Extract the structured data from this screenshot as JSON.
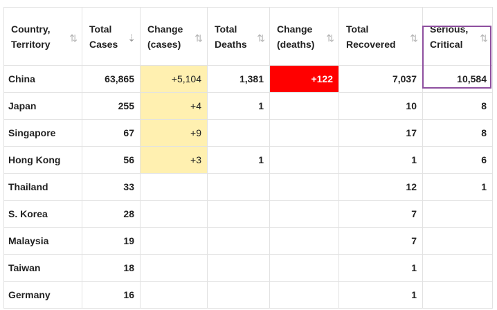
{
  "table": {
    "columns": [
      {
        "label_line1": "Country,",
        "label_line2": "Territory",
        "sort_icon": "sort-updown-icon"
      },
      {
        "label_line1": "Total",
        "label_line2": "Cases",
        "sort_icon": "sort-descending-icon"
      },
      {
        "label_line1": "Change",
        "label_line2": "(cases)",
        "sort_icon": "sort-updown-icon"
      },
      {
        "label_line1": "Total",
        "label_line2": "Deaths",
        "sort_icon": "sort-updown-icon"
      },
      {
        "label_line1": "Change",
        "label_line2": "(deaths)",
        "sort_icon": "sort-updown-icon"
      },
      {
        "label_line1": "Total",
        "label_line2": "Recovered",
        "sort_icon": "sort-updown-icon"
      },
      {
        "label_line1": "Serious,",
        "label_line2": "Critical",
        "sort_icon": "sort-updown-icon"
      }
    ],
    "rows": [
      {
        "country": "China",
        "total_cases": "63,865",
        "change_cases": "+5,104",
        "total_deaths": "1,381",
        "change_deaths": "+122",
        "total_recovered": "7,037",
        "serious_critical": "10,584"
      },
      {
        "country": "Japan",
        "total_cases": "255",
        "change_cases": "+4",
        "total_deaths": "1",
        "change_deaths": "",
        "total_recovered": "10",
        "serious_critical": "8"
      },
      {
        "country": "Singapore",
        "total_cases": "67",
        "change_cases": "+9",
        "total_deaths": "",
        "change_deaths": "",
        "total_recovered": "17",
        "serious_critical": "8"
      },
      {
        "country": "Hong Kong",
        "total_cases": "56",
        "change_cases": "+3",
        "total_deaths": "1",
        "change_deaths": "",
        "total_recovered": "1",
        "serious_critical": "6"
      },
      {
        "country": "Thailand",
        "total_cases": "33",
        "change_cases": "",
        "total_deaths": "",
        "change_deaths": "",
        "total_recovered": "12",
        "serious_critical": "1"
      },
      {
        "country": "S. Korea",
        "total_cases": "28",
        "change_cases": "",
        "total_deaths": "",
        "change_deaths": "",
        "total_recovered": "7",
        "serious_critical": ""
      },
      {
        "country": "Malaysia",
        "total_cases": "19",
        "change_cases": "",
        "total_deaths": "",
        "change_deaths": "",
        "total_recovered": "7",
        "serious_critical": ""
      },
      {
        "country": "Taiwan",
        "total_cases": "18",
        "change_cases": "",
        "total_deaths": "",
        "change_deaths": "",
        "total_recovered": "1",
        "serious_critical": ""
      },
      {
        "country": "Germany",
        "total_cases": "16",
        "change_cases": "",
        "total_deaths": "",
        "change_deaths": "",
        "total_recovered": "1",
        "serious_critical": ""
      }
    ]
  },
  "colors": {
    "change_cases_bg": "#fff0b0",
    "change_deaths_bg": "#ff0000",
    "highlight_border": "#8e4f9f"
  }
}
